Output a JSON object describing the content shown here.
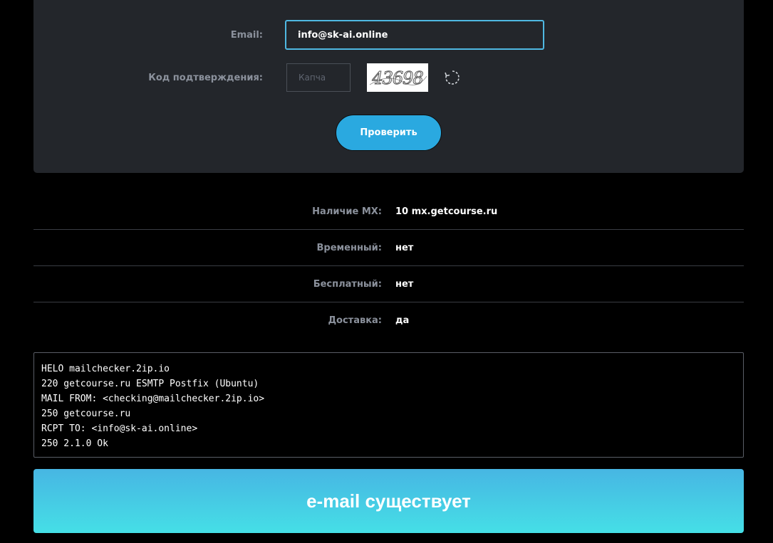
{
  "form": {
    "email_label": "Email:",
    "email_value": "info@sk-ai.online",
    "captcha_label": "Код подтверждения:",
    "captcha_placeholder": "Капча",
    "captcha_image_text": "43698",
    "refresh_icon": "refresh-icon",
    "check_button": "Проверить"
  },
  "results": [
    {
      "label": "Наличие MX:",
      "value": "10 mx.getcourse.ru"
    },
    {
      "label": "Временный:",
      "value": "нет"
    },
    {
      "label": "Бесплатный:",
      "value": "нет"
    },
    {
      "label": "Доставка:",
      "value": "да"
    }
  ],
  "smtp_log": [
    "HELO mailchecker.2ip.io",
    "220 getcourse.ru ESMTP Postfix (Ubuntu)",
    "MAIL FROM: <checking@mailchecker.2ip.io>",
    "250 getcourse.ru",
    "RCPT TO: <info@sk-ai.online>",
    "250 2.1.0 Ok"
  ],
  "verdict": "e-mail существует",
  "colors": {
    "panel_bg": "#23262b",
    "accent": "#2aa9e0",
    "input_border": "#4fb8e2",
    "verdict_top": "#47b6e3",
    "verdict_bottom": "#45dfe6"
  }
}
